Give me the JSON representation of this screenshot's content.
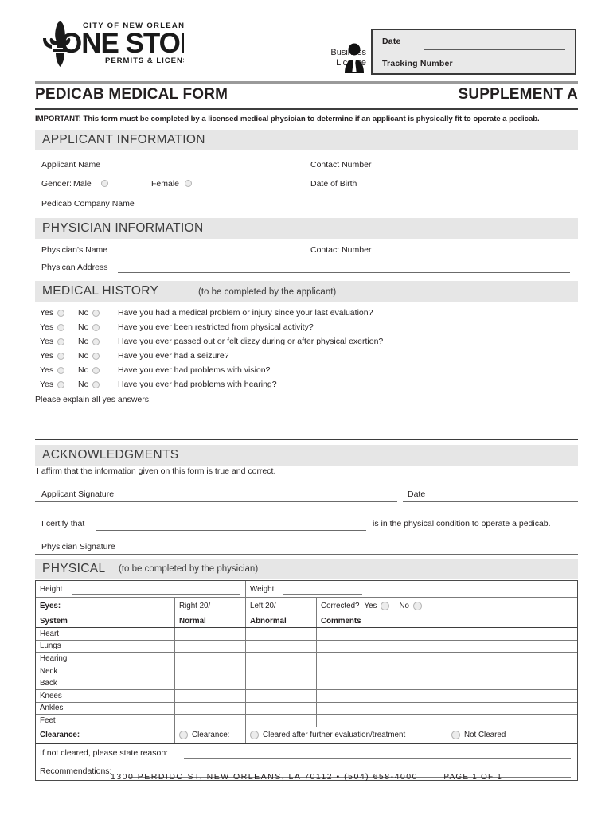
{
  "header": {
    "logo": {
      "city_line": "CITY OF NEW ORLEANS",
      "main": "ONE STOP",
      "sub": "PERMITS & LICENSES"
    },
    "business_license_label_line1": "Business",
    "business_license_label_line2": "License",
    "date_label": "Date",
    "tracking_label": "Tracking Number"
  },
  "title": {
    "left": "PEDICAB MEDICAL FORM",
    "right": "SUPPLEMENT A"
  },
  "important_notice": "IMPORTANT:  This form must be completed by a licensed medical physician to determine if an applicant is physically fit to operate a pedicab.",
  "applicant_section": {
    "heading": "APPLICANT INFORMATION",
    "applicant_name_label": "Applicant Name",
    "contact_number_label": "Contact Number",
    "gender_label": "Gender:",
    "male_label": "Male",
    "female_label": "Female",
    "date_of_birth_label": "Date of Birth",
    "company_name_label": "Pedicab Company Name"
  },
  "physician_section": {
    "heading": "PHYSICIAN INFORMATION",
    "physician_name_label": "Physician's Name",
    "contact_number_label": "Contact Number",
    "physician_address_label": "Physican Address"
  },
  "medical_history": {
    "heading": "MEDICAL HISTORY",
    "heading_suffix": "(to be completed by the applicant)",
    "yes_label": "Yes",
    "no_label": "No",
    "questions": [
      "Have you had a medical problem or injury since your last evaluation?",
      "Have you ever been restricted from physical activity?",
      "Have you ever passed out or felt dizzy during or after physical exertion?",
      "Have you ever had a seizure?",
      "Have you ever had problems with vision?",
      "Have you ever had problems with hearing?"
    ],
    "explain_label": "Please explain all yes answers:"
  },
  "acknowledgments": {
    "heading": "ACKNOWLEDGMENTS",
    "affirm_text": "I affirm that the information given on this form is true and correct.",
    "applicant_signature_label": "Applicant Signature",
    "date_label": "Date",
    "certify_prefix": "I certify that",
    "certify_suffix": "is in the physical condition to operate a pedicab.",
    "physician_signature_label": "Physician Signature"
  },
  "physical": {
    "heading": "PHYSICAL",
    "heading_suffix": "(to be completed by the physician)",
    "height_label": "Height",
    "weight_label": "Weight",
    "eyes_label": "Eyes:",
    "right_eye_label": "Right 20/",
    "left_eye_label": "Left 20/",
    "corrected_label": "Corrected?",
    "corrected_yes": "Yes",
    "corrected_no": "No",
    "columns": {
      "system": "System",
      "normal": "Normal",
      "abnormal": "Abnormal",
      "comments": "Comments"
    },
    "systems": [
      "Heart",
      "Lungs",
      "Hearing",
      "Neck",
      "Back",
      "Knees",
      "Ankles",
      "Feet"
    ],
    "clearance_label": "Clearance:",
    "clearance_options": [
      "Clearance:",
      "Cleared after further evaluation/treatment",
      "Not Cleared"
    ],
    "not_cleared_reason_label": "If not cleared, please state reason:",
    "recommendations_label": "Recommendations:"
  },
  "footer": {
    "address": "1300 PERDIDO ST, NEW ORLEANS, LA 70112 • (504) 658-4000",
    "page": "PAGE 1 OF 1"
  }
}
